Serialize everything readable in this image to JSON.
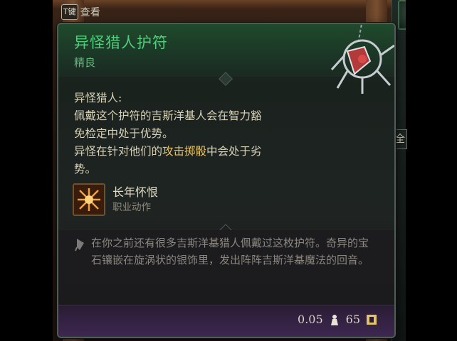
{
  "hud": {
    "view_key": "T键",
    "view_label": "查看",
    "side_button_label": "全"
  },
  "item": {
    "name": "异怪猎人护符",
    "rarity": "精良",
    "effect_title": "异怪猎人:",
    "effect_lines": [
      "佩戴这个护符的吉斯洋基人会在智力豁",
      "免检定中处于优势。",
      "异怪在针对他们的",
      "攻击掷骰",
      "中会处于劣",
      "势。"
    ],
    "action": {
      "name": "长年怀恨",
      "type": "职业动作",
      "icon": "grudge-action-icon"
    },
    "lore": "在你之前还有很多吉斯洋基猎人佩戴过这枚护符。奇异的宝石镶嵌在旋涡状的银饰里，发出阵阵吉斯洋基魔法的回音。",
    "weight": "0.05",
    "value": "65",
    "weight_icon": "weight-icon",
    "rarity_icon": "amulet-slot-icon"
  },
  "colors": {
    "title_green": "#4fd07a",
    "highlight_gold": "#e6c467",
    "footer_purple": "#3d2750"
  }
}
